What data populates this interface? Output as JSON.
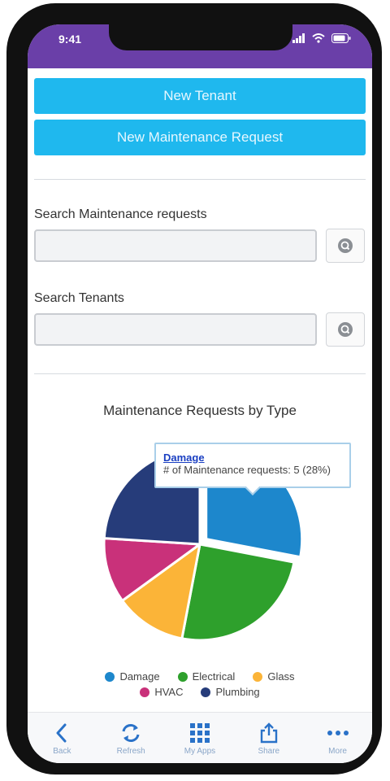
{
  "status_bar": {
    "time": "9:41"
  },
  "actions": {
    "new_tenant": "New Tenant",
    "new_maintenance_request": "New Maintenance Request"
  },
  "search_maintenance": {
    "label": "Search Maintenance requests",
    "value": "",
    "placeholder": ""
  },
  "search_tenants": {
    "label": "Search Tenants",
    "value": "",
    "placeholder": ""
  },
  "chart_data": {
    "type": "pie",
    "title": "Maintenance Requests by Type",
    "categories": [
      "Damage",
      "Electrical",
      "Glass",
      "HVAC",
      "Plumbing"
    ],
    "values": [
      28,
      25,
      12,
      11,
      24
    ],
    "colors": [
      "#1d87cc",
      "#2ea02c",
      "#fbb438",
      "#c9317a",
      "#263c7a"
    ],
    "exploded": "Damage",
    "legend": "bottom",
    "tooltip": {
      "title": "Damage",
      "text": "# of Maintenance requests: 5 (28%)"
    }
  },
  "tabbar": {
    "items": [
      {
        "label": "Back",
        "icon": "chevron-left-icon"
      },
      {
        "label": "Refresh",
        "icon": "refresh-icon"
      },
      {
        "label": "My Apps",
        "icon": "grid-icon"
      },
      {
        "label": "Share",
        "icon": "share-icon"
      },
      {
        "label": "More",
        "icon": "more-icon"
      }
    ]
  },
  "colors": {
    "accent": "#1fb8ee",
    "status_bar": "#6a3fa8",
    "tab_icon": "#2a72c8"
  }
}
